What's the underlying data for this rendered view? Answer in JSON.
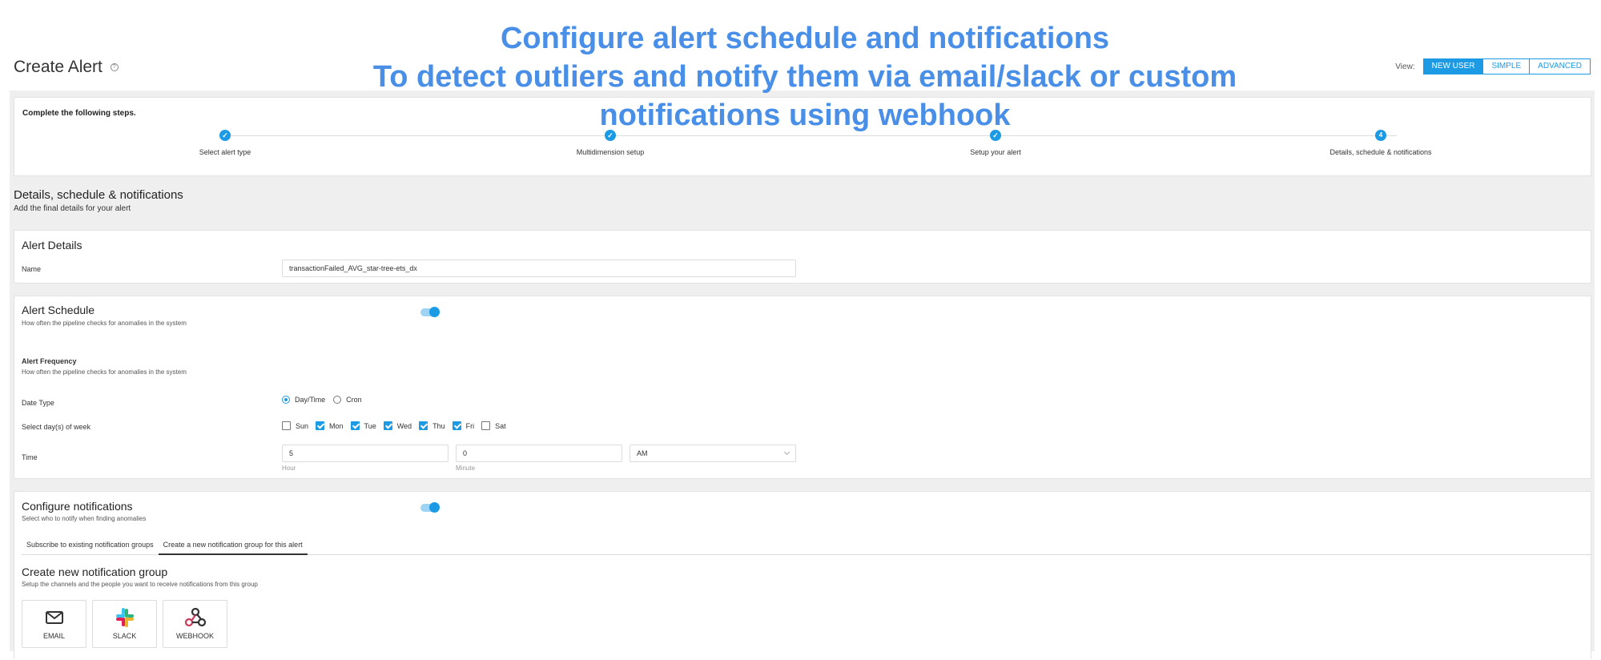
{
  "overlay": {
    "line1": "Configure alert schedule and notifications",
    "line2": "To detect outliers and notify them via email/slack or custom",
    "line3": "notifications using webhook"
  },
  "page": {
    "title": "Create Alert",
    "view_label": "View:",
    "views": [
      "NEW USER",
      "SIMPLE",
      "ADVANCED"
    ],
    "active_view": "NEW USER"
  },
  "steps": {
    "intro": "Complete the following steps.",
    "items": [
      {
        "label": "Select alert type",
        "status": "done",
        "marker": "✓"
      },
      {
        "label": "Multidimension setup",
        "status": "done",
        "marker": "✓"
      },
      {
        "label": "Setup your alert",
        "status": "done",
        "marker": "✓"
      },
      {
        "label": "Details, schedule & notifications",
        "status": "current",
        "marker": "4"
      }
    ]
  },
  "section": {
    "title": "Details, schedule & notifications",
    "subtitle": "Add the final details for your alert"
  },
  "alert_details": {
    "title": "Alert Details",
    "name_label": "Name",
    "name_value": "transactionFailed_AVG_star-tree-ets_dx"
  },
  "schedule": {
    "title": "Alert Schedule",
    "subtitle": "How often the pipeline checks for anomalies in the system",
    "enabled": true,
    "frequency_title": "Alert Frequency",
    "frequency_subtitle": "How often the pipeline checks for anomalies in the system",
    "date_type_label": "Date Type",
    "date_type_options": [
      "Day/Time",
      "Cron"
    ],
    "date_type_selected": "Day/Time",
    "days_label": "Select day(s) of week",
    "days": [
      {
        "label": "Sun",
        "checked": false
      },
      {
        "label": "Mon",
        "checked": true
      },
      {
        "label": "Tue",
        "checked": true
      },
      {
        "label": "Wed",
        "checked": true
      },
      {
        "label": "Thu",
        "checked": true
      },
      {
        "label": "Fri",
        "checked": true
      },
      {
        "label": "Sat",
        "checked": false
      }
    ],
    "time_label": "Time",
    "hour_value": "5",
    "hour_hint": "Hour",
    "minute_value": "0",
    "minute_hint": "Minute",
    "meridiem_value": "AM"
  },
  "notifications": {
    "title": "Configure notifications",
    "subtitle": "Select who to notify when finding anomalies",
    "enabled": true,
    "tabs": [
      "Subscribe to existing notification groups",
      "Create a new notification group for this alert"
    ],
    "active_tab": "Create a new notification group for this alert",
    "group_title": "Create new notification group",
    "group_subtitle": "Setup the channels and the people you want to receive notifications from this group",
    "channels": [
      {
        "label": "EMAIL",
        "icon": "envelope-icon"
      },
      {
        "label": "SLACK",
        "icon": "slack-icon"
      },
      {
        "label": "WEBHOOK",
        "icon": "webhook-icon"
      }
    ]
  },
  "colors": {
    "accent": "#1d9ae4",
    "overlay_text": "#4a8fe7",
    "band": "#efefef"
  }
}
